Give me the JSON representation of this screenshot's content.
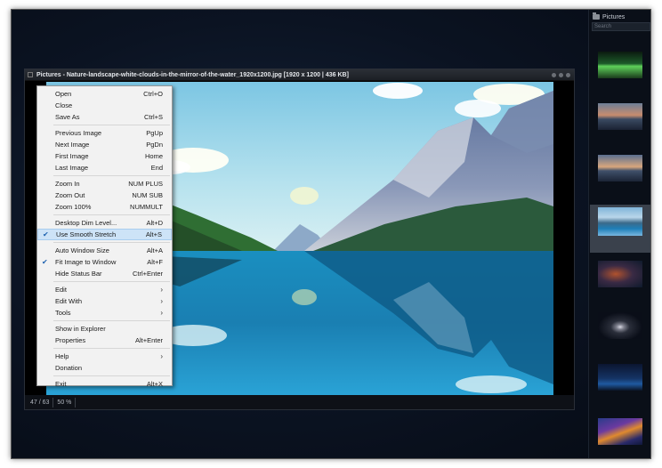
{
  "window": {
    "title": "Pictures - Nature-landscape-white-clouds-in-the-mirror-of-the-water_1920x1200.jpg  [1920 x 1200  |  436 KB]"
  },
  "status": {
    "position": "47 / 63",
    "zoom": "50 %"
  },
  "sidebar": {
    "title": "Pictures",
    "search_placeholder": "Search",
    "selected_index": 3,
    "thumbnails": [
      {
        "icon": "green-light-trail-thumbnail"
      },
      {
        "icon": "sunset-mountains-thumbnail"
      },
      {
        "icon": "sunset-landscape-thumbnail"
      },
      {
        "icon": "lake-mountains-thumbnail"
      },
      {
        "icon": "nebula-thumbnail"
      },
      {
        "icon": "saturn-thumbnail"
      },
      {
        "icon": "blue-city-night-thumbnail"
      },
      {
        "icon": "colorful-waves-thumbnail"
      }
    ]
  },
  "context_menu": {
    "groups": [
      [
        {
          "label": "Open",
          "shortcut": "Ctrl+O"
        },
        {
          "label": "Close",
          "shortcut": ""
        },
        {
          "label": "Save As",
          "shortcut": "Ctrl+S"
        }
      ],
      [
        {
          "label": "Previous Image",
          "shortcut": "PgUp"
        },
        {
          "label": "Next Image",
          "shortcut": "PgDn"
        },
        {
          "label": "First Image",
          "shortcut": "Home"
        },
        {
          "label": "Last Image",
          "shortcut": "End"
        }
      ],
      [
        {
          "label": "Zoom In",
          "shortcut": "NUM PLUS"
        },
        {
          "label": "Zoom Out",
          "shortcut": "NUM SUB"
        },
        {
          "label": "Zoom 100%",
          "shortcut": "NUMMULT"
        }
      ],
      [
        {
          "label": "Desktop Dim Level...",
          "shortcut": "Alt+D"
        },
        {
          "label": "Use Smooth Stretch",
          "shortcut": "Alt+S",
          "checked": true,
          "highlighted": true
        }
      ],
      [
        {
          "label": "Auto Window Size",
          "shortcut": "Alt+A"
        },
        {
          "label": "Fit Image to Window",
          "shortcut": "Alt+F",
          "checked": true
        },
        {
          "label": "Hide Status Bar",
          "shortcut": "Ctrl+Enter"
        }
      ],
      [
        {
          "label": "Edit",
          "shortcut": "",
          "submenu": true
        },
        {
          "label": "Edit With",
          "shortcut": "",
          "submenu": true
        },
        {
          "label": "Tools",
          "shortcut": "",
          "submenu": true
        }
      ],
      [
        {
          "label": "Show in Explorer",
          "shortcut": ""
        },
        {
          "label": "Properties",
          "shortcut": "Alt+Enter"
        }
      ],
      [
        {
          "label": "Help",
          "shortcut": "",
          "submenu": true
        },
        {
          "label": "Donation",
          "shortcut": ""
        }
      ],
      [
        {
          "label": "Exit",
          "shortcut": "Alt+X"
        }
      ]
    ]
  },
  "colors": {
    "menu_highlight": "#cde3f7",
    "check": "#1e62b0"
  }
}
